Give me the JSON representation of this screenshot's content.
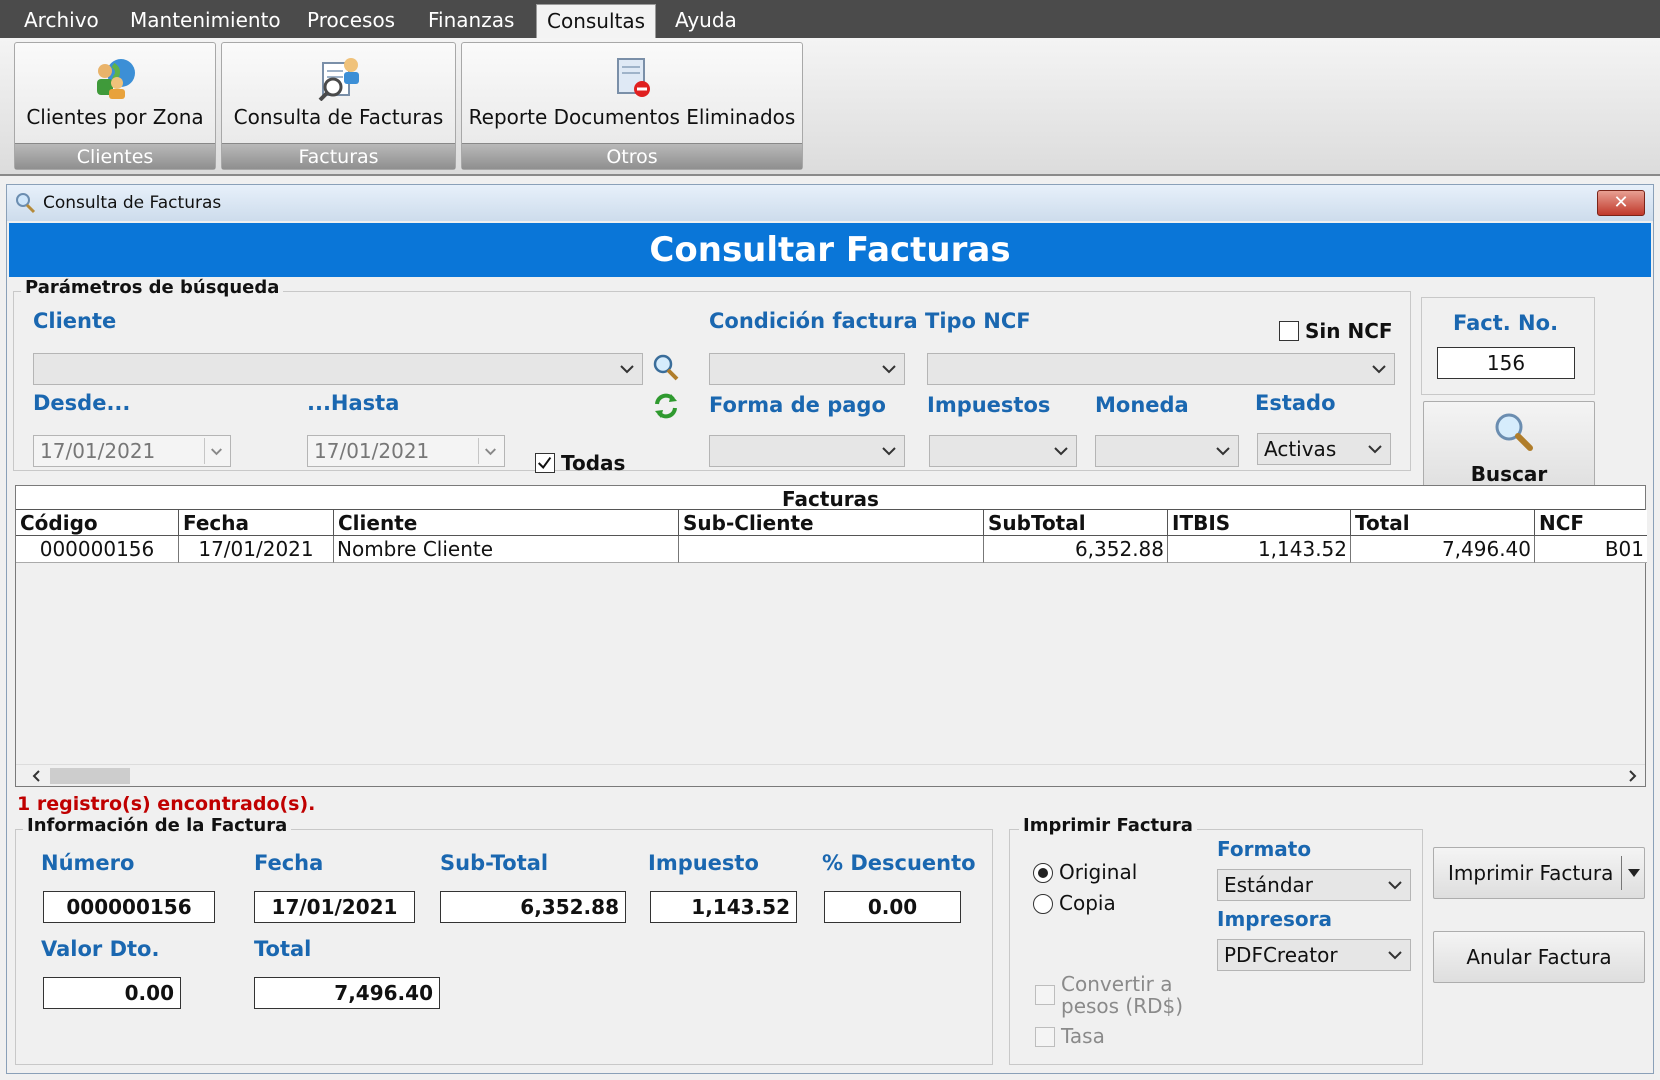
{
  "menu": [
    "Archivo",
    "Mantenimiento",
    "Procesos",
    "Finanzas",
    "Consultas",
    "Ayuda"
  ],
  "ribbon": {
    "groups": [
      {
        "button": "Clientes por Zona",
        "caption": "Clientes",
        "icon": "clients-zone-icon"
      },
      {
        "button": "Consulta de Facturas",
        "caption": "Facturas",
        "icon": "invoice-search-icon"
      },
      {
        "button": "Reporte Documentos Eliminados",
        "caption": "Otros",
        "icon": "deleted-docs-report-icon"
      }
    ]
  },
  "window": {
    "title": "Consulta de Facturas",
    "banner": "Consultar Facturas",
    "close_glyph": "✕"
  },
  "search": {
    "legend": "Parámetros de búsqueda",
    "cliente_label": "Cliente",
    "cliente_value": "",
    "desde_label": "Desde...",
    "desde_value": "17/01/2021",
    "hasta_label": "...Hasta",
    "hasta_value": "17/01/2021",
    "todas_label": "Todas",
    "todas_checked": true,
    "condicion_label": "Condición factura",
    "condicion_value": "",
    "tipo_ncf_label": "Tipo NCF",
    "tipo_ncf_value": "",
    "sin_ncf_label": "Sin NCF",
    "sin_ncf_checked": false,
    "forma_pago_label": "Forma de pago",
    "forma_pago_value": "",
    "impuestos_label": "Impuestos",
    "impuestos_value": "",
    "moneda_label": "Moneda",
    "moneda_value": "",
    "estado_label": "Estado",
    "estado_value": "Activas",
    "fact_no_label": "Fact. No.",
    "fact_no_value": "156",
    "buscar_label": "Buscar"
  },
  "grid": {
    "caption": "Facturas",
    "columns": [
      "Código",
      "Fecha",
      "Cliente",
      "Sub-Cliente",
      "SubTotal",
      "ITBIS",
      "Total",
      "NCF"
    ],
    "rows": [
      [
        "000000156",
        "17/01/2021",
        "Nombre Cliente",
        "",
        "6,352.88",
        "1,143.52",
        "7,496.40",
        "B01"
      ]
    ],
    "records_text": "1 registro(s) encontrado(s)."
  },
  "info": {
    "legend": "Información de la Factura",
    "numero_label": "Número",
    "numero_value": "000000156",
    "fecha_label": "Fecha",
    "fecha_value": "17/01/2021",
    "subtotal_label": "Sub-Total",
    "subtotal_value": "6,352.88",
    "impuesto_label": "Impuesto",
    "impuesto_value": "1,143.52",
    "descuento_label": "% Descuento",
    "descuento_value": "0.00",
    "valor_dto_label": "Valor Dto.",
    "valor_dto_value": "0.00",
    "total_label": "Total",
    "total_value": "7,496.40"
  },
  "print": {
    "legend": "Imprimir Factura",
    "original_label": "Original",
    "copia_label": "Copia",
    "selected": "Original",
    "convertir_line1": "Convertir a",
    "convertir_line2": "pesos (RD$)",
    "tasa_label": "Tasa",
    "formato_label": "Formato",
    "formato_value": "Estándar",
    "impresora_label": "Impresora",
    "impresora_value": "PDFCreator",
    "imprimir_button": "Imprimir Factura",
    "anular_button": "Anular Factura"
  },
  "colors": {
    "accent": "#0a76d8",
    "label_blue": "#1a67b0",
    "records_red": "#c00000",
    "menubar": "#4b4b4b"
  }
}
